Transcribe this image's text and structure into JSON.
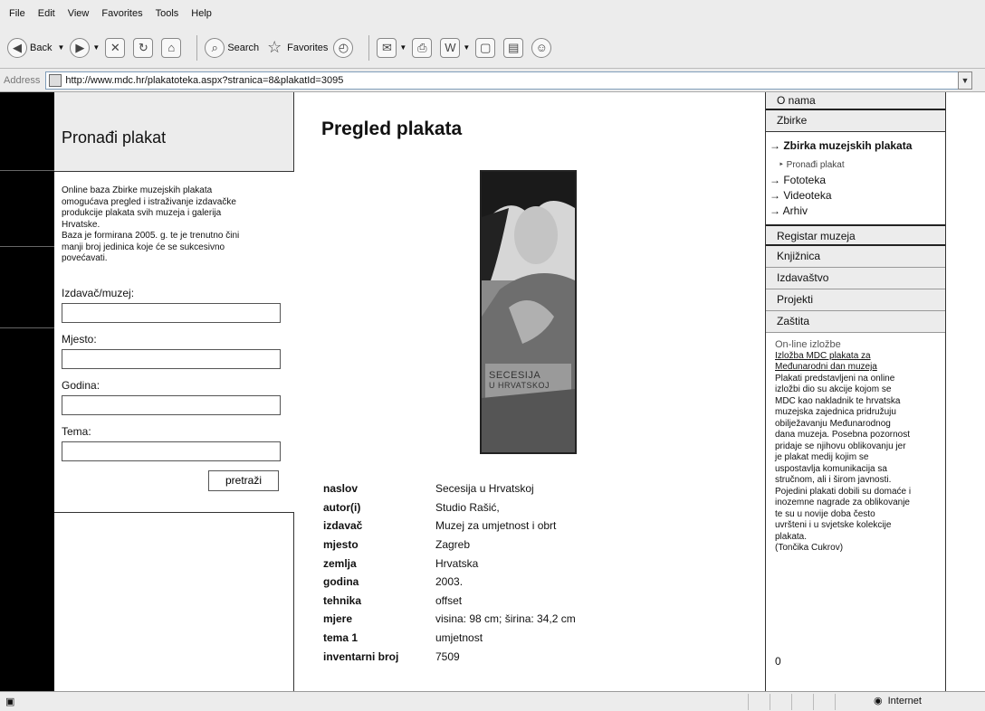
{
  "browser": {
    "menu": [
      "File",
      "Edit",
      "View",
      "Favorites",
      "Tools",
      "Help"
    ],
    "toolbar": {
      "back": "Back",
      "search": "Search",
      "favorites": "Favorites"
    },
    "address_label": "Address",
    "url": "http://www.mdc.hr/plakatoteka.aspx?stranica=8&plakatId=3095",
    "status_zone": "Internet"
  },
  "left": {
    "heading": "Pronađi plakat",
    "intro": [
      "Online baza Zbirke muzejskih plakata",
      "omogućava pregled i istraživanje izdavačke",
      "produkcije plakata svih muzeja i galerija",
      "Hrvatske.",
      "Baza je formirana 2005. g. te je trenutno čini",
      "manji broj jedinica koje će se sukcesivno",
      "povećavati."
    ],
    "fields": [
      {
        "label": "Izdavač/muzej:"
      },
      {
        "label": "Mjesto:"
      },
      {
        "label": "Godina:"
      },
      {
        "label": "Tema:"
      }
    ],
    "search_button": "pretraži"
  },
  "main": {
    "title": "Pregled plakata",
    "poster_text": [
      "SECESIJA",
      "U HRVATSKOJ"
    ],
    "details": [
      {
        "key": "naslov",
        "value": "Secesija u Hrvatskoj"
      },
      {
        "key": "autor(i)",
        "value": "Studio Rašić,"
      },
      {
        "key": "izdavač",
        "value": "Muzej za umjetnost i obrt"
      },
      {
        "key": "mjesto",
        "value": "Zagreb"
      },
      {
        "key": "zemlja",
        "value": "Hrvatska"
      },
      {
        "key": "godina",
        "value": "2003."
      },
      {
        "key": "tehnika",
        "value": "offset"
      },
      {
        "key": "mjere",
        "value": "visina: 98 cm; širina: 34,2 cm"
      },
      {
        "key": "tema 1",
        "value": "umjetnost"
      },
      {
        "key": "inventarni broj",
        "value": "7509"
      }
    ]
  },
  "right": {
    "top_items": [
      "O nama",
      "Zbirke"
    ],
    "sub_items": [
      {
        "label": "→ Zbirka muzejskih plakata"
      },
      {
        "label": "‣ Pronađi plakat"
      },
      {
        "label": "→ Fototeka"
      },
      {
        "label": "→ Videoteka"
      },
      {
        "label": "→ Arhiv"
      }
    ],
    "nav_items": [
      "Registar muzeja",
      "Knjižnica",
      "Izdavaštvo",
      "Projekti",
      "Zaštita"
    ],
    "expo_title": "On-line izložbe",
    "expo_link": [
      "Izložba MDC plakata za",
      "Međunarodni dan muzeja"
    ],
    "expo_text": [
      "Plakati predstavljeni na online",
      "izložbi dio su akcije kojom se",
      "MDC kao nakladnik te hrvatska",
      "muzejska zajednica pridružuju",
      "obilježavanju Međunarodnog",
      "dana muzeja. Posebna pozornost",
      "pridaje se njihovu oblikovanju jer",
      "je plakat medij kojim se",
      "uspostavlja komunikacija sa",
      "stručnom, ali i širom javnosti.",
      "Pojedini plakati dobili su domaće i",
      "inozemne nagrade za oblikovanje",
      "te su u novije doba često",
      "uvršteni i u svjetske kolekcije",
      "plakata.",
      "(Tončika Cukrov)"
    ],
    "counter": "0"
  }
}
